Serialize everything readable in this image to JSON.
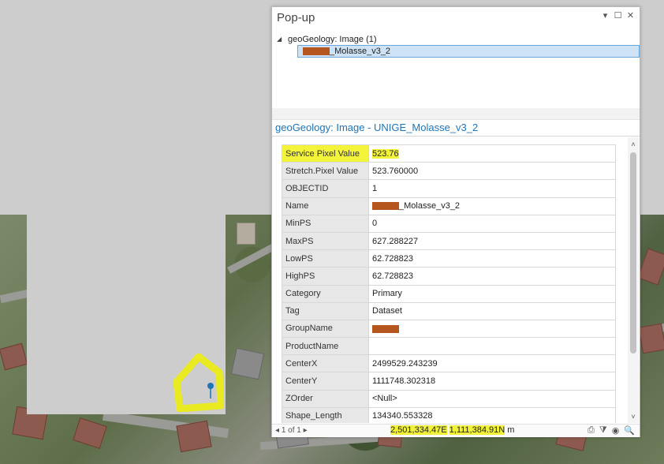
{
  "popup": {
    "title": "Pop-up",
    "controls": {
      "pin": "▾",
      "restore": "☐",
      "close": "✕"
    },
    "tree": {
      "toggle": "◢",
      "layer_label": "geoGeology: Image  (1)",
      "child_label": "_Molasse_v3_2"
    },
    "heading": "geoGeology: Image - UNIGE_Molasse_v3_2",
    "rows": [
      {
        "field": "Service Pixel Value",
        "value": "523.76",
        "highlight": true
      },
      {
        "field": "Stretch.Pixel Value",
        "value": "523.760000"
      },
      {
        "field": "OBJECTID",
        "value": "1"
      },
      {
        "field": "Name",
        "value": "_Molasse_v3_2",
        "redacted": true
      },
      {
        "field": "MinPS",
        "value": "0"
      },
      {
        "field": "MaxPS",
        "value": "627.288227"
      },
      {
        "field": "LowPS",
        "value": "62.728823"
      },
      {
        "field": "HighPS",
        "value": "62.728823"
      },
      {
        "field": "Category",
        "value": "Primary"
      },
      {
        "field": "Tag",
        "value": "Dataset"
      },
      {
        "field": "GroupName",
        "value": "",
        "redacted": true
      },
      {
        "field": "ProductName",
        "value": ""
      },
      {
        "field": "CenterX",
        "value": "2499529.243239"
      },
      {
        "field": "CenterY",
        "value": "1111748.302318"
      },
      {
        "field": "ZOrder",
        "value": "<Null>"
      },
      {
        "field": "Shape_Length",
        "value": "134340.553328"
      }
    ],
    "scroll": {
      "up": "˄",
      "down": "˅"
    },
    "footer": {
      "pager_prev": "◂",
      "pager_text": "1 of 1",
      "pager_next": "▸",
      "coord_x": "2,501,334.47E",
      "coord_y": "1,111,384.91N",
      "coord_unit": "m",
      "icons": {
        "print": "⎙",
        "filter": "⧩",
        "flash": "◉",
        "zoom": "🔍"
      }
    }
  },
  "colors": {
    "highlight": "#f3f33a",
    "heading_blue": "#1f74b5",
    "selection": "#cde3f5",
    "redaction": "#b4561d"
  }
}
